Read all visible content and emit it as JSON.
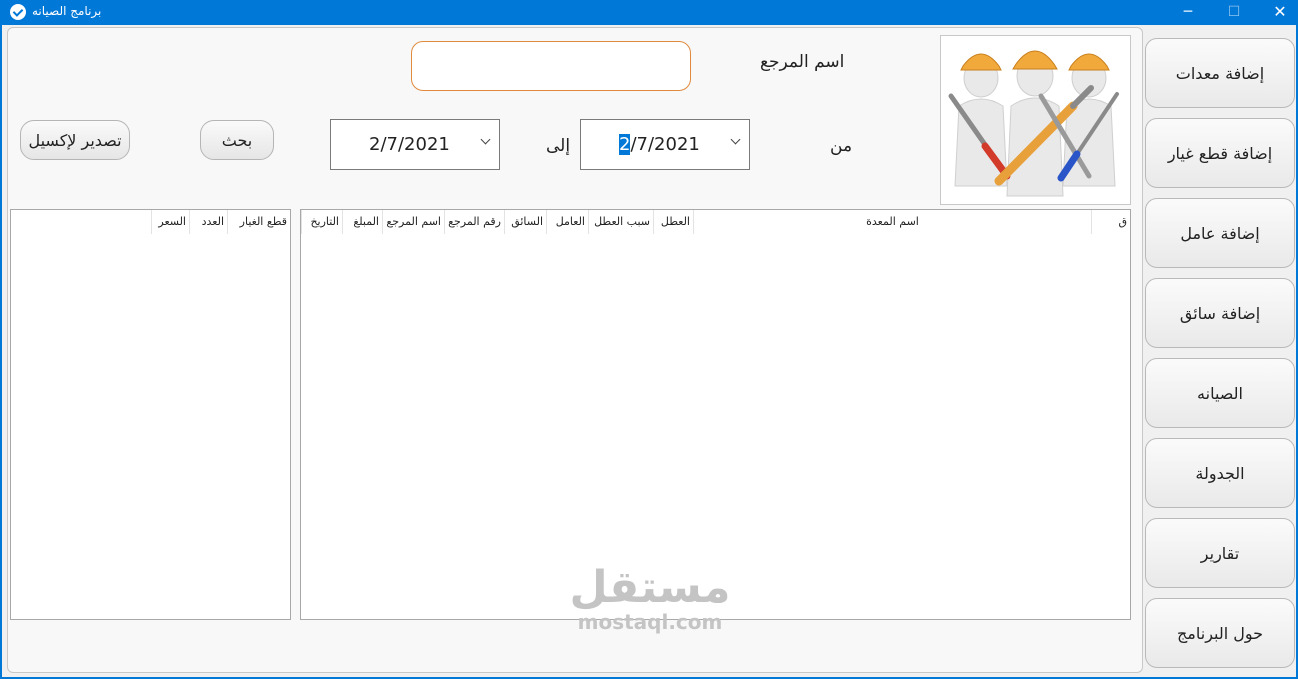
{
  "window": {
    "title": "برنامج الصيانه",
    "minimize_glyph": "─",
    "maximize_glyph": "☐",
    "close_glyph": "✕"
  },
  "form": {
    "reference_name_label": "اسم المرجع",
    "reference_name_value": "",
    "from_label": "من",
    "to_label": "إلى",
    "from_date_selected": "2",
    "from_date_rest": "/7/2021",
    "to_date": "2/7/2021",
    "search_button": "بحث",
    "export_button": "تصدير لإكسيل"
  },
  "maintenance_table": {
    "columns": [
      "ق",
      "اسم المعدة",
      "العطل",
      "سبب العطل",
      "العامل",
      "السائق",
      "رقم المرجع",
      "اسم المرجع",
      "المبلغ",
      "التاريخ"
    ],
    "rows": []
  },
  "parts_table": {
    "columns": [
      "قطع الغيار",
      "العدد",
      "السعر"
    ],
    "rows": []
  },
  "sidebar": {
    "items": [
      {
        "label": "إضافة معدات"
      },
      {
        "label": "إضافة قطع غيار"
      },
      {
        "label": "إضافة عامل"
      },
      {
        "label": "إضافة سائق"
      },
      {
        "label": "الصيانه"
      },
      {
        "label": "الجدولة"
      },
      {
        "label": "تقارير"
      },
      {
        "label": "حول البرنامج"
      }
    ]
  },
  "watermark": {
    "arabic": "مستقل",
    "latin": "mostaql.com"
  },
  "colors": {
    "titlebar": "#0078d7",
    "input_border": "#e08a3c",
    "helmet": "#f2a93b",
    "tool_orange": "#e8a03a",
    "tool_red": "#d23a2a",
    "tool_blue": "#2a55c8"
  }
}
